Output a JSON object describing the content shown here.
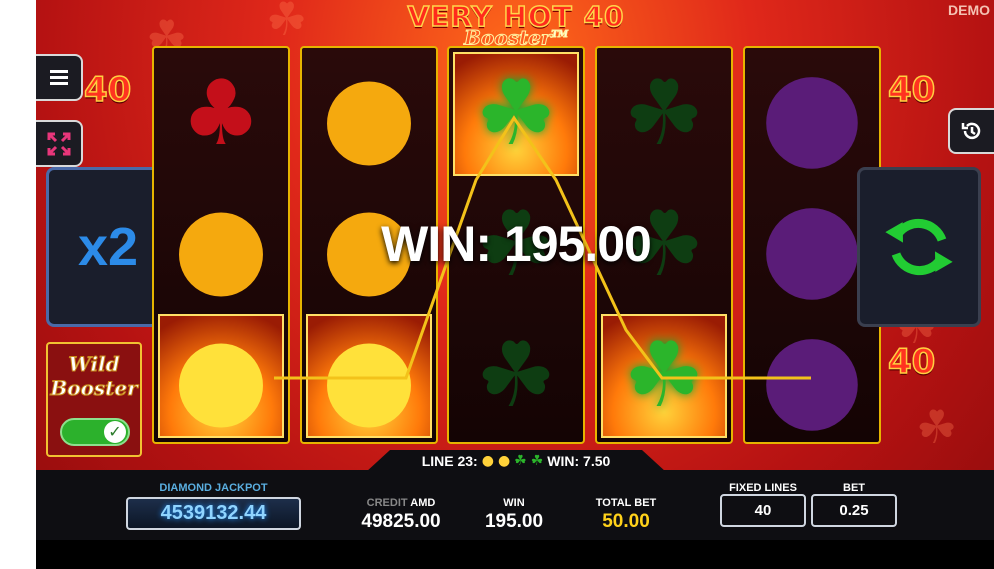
{
  "title": {
    "line1": "VERY HOT 40",
    "line2": "Booster",
    "tm": "TM"
  },
  "demo_label": "DEMO",
  "lines_indicator": "40",
  "multiplier": "x2",
  "wild_booster": {
    "line1": "Wild",
    "line2": "Booster",
    "enabled": true
  },
  "big_win": "WIN: 195.00",
  "line_win": {
    "label": "LINE 23:",
    "win": "WIN: 7.50"
  },
  "reels": [
    [
      "cherry",
      "lemon",
      "lemon-win"
    ],
    [
      "lemon",
      "lemon",
      "lemon-win"
    ],
    [
      "clover-win",
      "clover",
      "clover"
    ],
    [
      "clover",
      "clover",
      "clover-win"
    ],
    [
      "plum",
      "plum",
      "plum"
    ]
  ],
  "jackpot": {
    "label": "DIAMOND JACKPOT",
    "value": "4539132.44"
  },
  "credit": {
    "label": "CREDIT",
    "currency": "AMD",
    "value": "49825.00"
  },
  "win": {
    "label": "WIN",
    "value": "195.00"
  },
  "total_bet": {
    "label": "TOTAL BET",
    "value": "50.00"
  },
  "fixed_lines": {
    "label": "FIXED LINES",
    "value": "40"
  },
  "bet": {
    "label": "BET",
    "value": "0.25"
  },
  "colors": {
    "win_line": "#f3c21a",
    "multiplier": "#2c8be8",
    "spin": "#22cc33",
    "total_bet": "#ffd21a"
  }
}
